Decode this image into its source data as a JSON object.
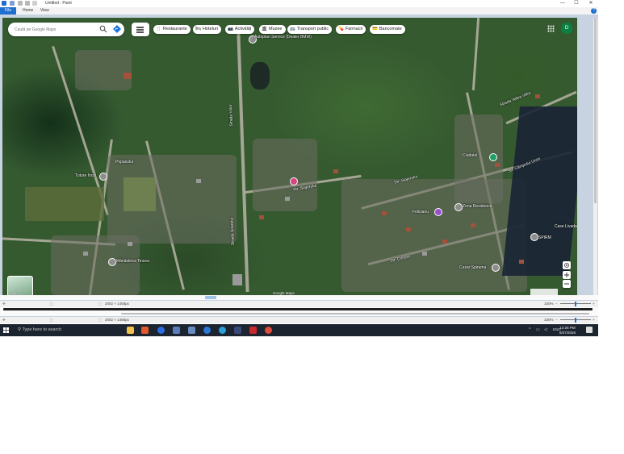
{
  "window": {
    "title": "Untitled - Paint",
    "controls": [
      "—",
      "☐",
      "✕"
    ]
  },
  "ribbon": {
    "tabs": [
      "File",
      "Home",
      "View"
    ],
    "help": "?"
  },
  "map": {
    "search_placeholder": "Caută pe Google Maps",
    "chips": [
      {
        "icon": "fork-knife-icon",
        "glyph": "🍴",
        "label": "Restaurante"
      },
      {
        "icon": "bed-icon",
        "glyph": "🛏",
        "label": "Hoteluri"
      },
      {
        "icon": "camera-icon",
        "glyph": "📷",
        "label": "Activități"
      },
      {
        "icon": "museum-icon",
        "glyph": "🏛",
        "label": "Muzee"
      },
      {
        "icon": "bus-icon",
        "glyph": "🚌",
        "label": "Transport public"
      },
      {
        "icon": "pharmacy-icon",
        "glyph": "💊",
        "label": "Farmacii"
      },
      {
        "icon": "atm-icon",
        "glyph": "💳",
        "label": "Bancomate"
      }
    ],
    "avatar_letter": "D",
    "layer_label": "Straturi",
    "attribution": "Google Maps",
    "labels": [
      {
        "name": "service",
        "text": "Autoplan Service (Dealer BMW)"
      },
      {
        "name": "tuture",
        "text": "Tuture Incel"
      },
      {
        "name": "popasului",
        "text": "Popasului"
      },
      {
        "name": "strada-siajerului",
        "text": "Str. Siajerului"
      },
      {
        "name": "strada-siajerului-2",
        "text": "Str. Siajerului"
      },
      {
        "name": "ciudatul",
        "text": "Ciudatul"
      },
      {
        "name": "manastirea",
        "text": "Mănăstirea Tincea"
      },
      {
        "name": "zona-residence",
        "text": "Zona Residence"
      },
      {
        "name": "felicianu",
        "text": "Felicianu"
      },
      {
        "name": "casa-livada",
        "text": "Case Livada"
      },
      {
        "name": "spirm",
        "text": "SPIRM"
      },
      {
        "name": "cezar",
        "text": "Cezar Spirama"
      },
      {
        "name": "strada-crinului",
        "text": "Str. Crinului"
      },
      {
        "name": "strada-valea",
        "text": "Strada Valea Viilor"
      },
      {
        "name": "strada-campului",
        "text": "Str. Câmpului Unirii"
      },
      {
        "name": "strada-viilor",
        "text": "Strada Viilor"
      },
      {
        "name": "strada-soarelui",
        "text": "Strada Soarelui"
      }
    ]
  },
  "statusbar": {
    "dimensions": "2002 × 1458px",
    "zoom": "100%",
    "zoom_fraction": 0.5
  },
  "taskbar": {
    "search_placeholder": "Type here to search",
    "lang": "ENG",
    "time": "12:25 PM",
    "date": "6/27/2026"
  },
  "colors": {
    "accent": "#1e6fd0",
    "taskbar": "#1c2430",
    "avatar": "#0b8043"
  }
}
